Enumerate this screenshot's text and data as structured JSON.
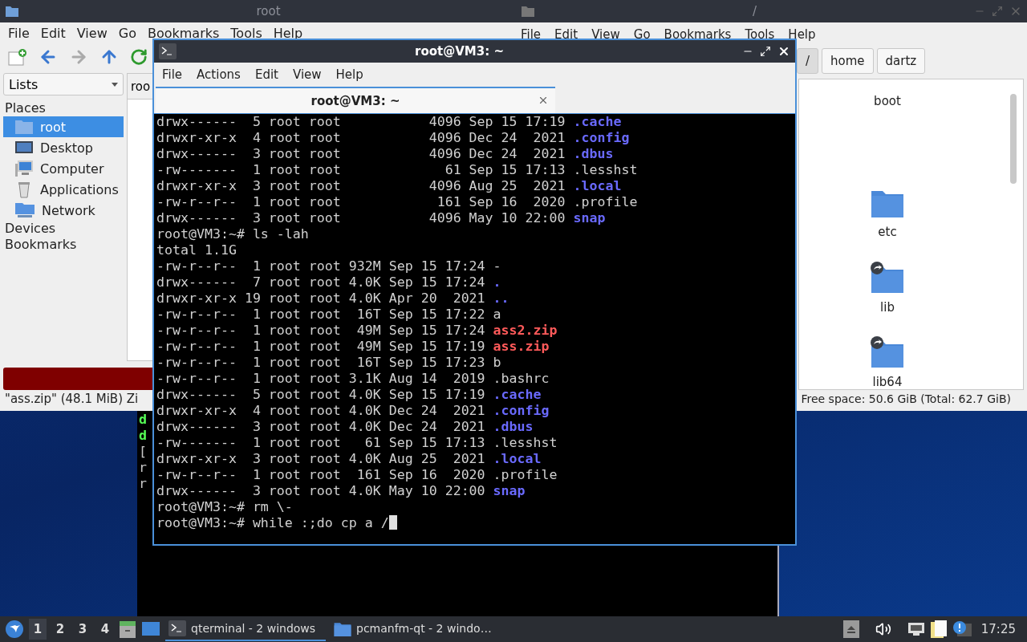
{
  "file_manager_left": {
    "title": "root",
    "menu": [
      "File",
      "Edit",
      "View",
      "Go",
      "Bookmarks",
      "Tools",
      "Help"
    ],
    "side_dropdown": "Lists",
    "places_header": "Places",
    "places": [
      {
        "label": "root",
        "kind": "home",
        "selected": true
      },
      {
        "label": "Desktop",
        "kind": "desktop",
        "selected": false
      },
      {
        "label": "Computer",
        "kind": "computer",
        "selected": false
      },
      {
        "label": "Applications",
        "kind": "applications",
        "selected": false
      },
      {
        "label": "Network",
        "kind": "network",
        "selected": false
      }
    ],
    "sections": [
      "Devices",
      "Bookmarks"
    ],
    "tab": "roo",
    "status": "\"ass.zip\" (48.1 MiB) Zi"
  },
  "file_manager_right": {
    "title": "/",
    "menu": [
      "File",
      "Edit",
      "View",
      "Go",
      "Bookmarks",
      "Tools",
      "Help"
    ],
    "path": [
      {
        "label": "/",
        "selected": true
      },
      {
        "label": "home",
        "selected": false
      },
      {
        "label": "dartz",
        "selected": false
      }
    ],
    "items": [
      {
        "label": "boot",
        "kind": "label"
      },
      {
        "label": "etc",
        "kind": "folder"
      },
      {
        "label": "lib",
        "kind": "link"
      },
      {
        "label": "lib64",
        "kind": "link"
      }
    ],
    "status": "Free space: 50.6 GiB (Total: 62.7 GiB)"
  },
  "background_terminal": {
    "lines": [
      {
        "text": "d",
        "kind": "green"
      },
      {
        "text": "d",
        "kind": "green"
      },
      {
        "text": "[",
        "kind": "plain"
      },
      {
        "text": "r",
        "kind": "plain"
      },
      {
        "text": "r",
        "kind": "plain"
      }
    ]
  },
  "terminal": {
    "title": "root@VM3: ~",
    "menu": [
      "File",
      "Actions",
      "Edit",
      "View",
      "Help"
    ],
    "tab": "root@VM3: ~",
    "cursor": true,
    "lines": [
      {
        "text": "drwx------  5 root root           4096 Sep 15 17:19 ",
        "name": ".cache",
        "kind": "dir"
      },
      {
        "text": "drwxr-xr-x  4 root root           4096 Dec 24  2021 ",
        "name": ".config",
        "kind": "dir"
      },
      {
        "text": "drwx------  3 root root           4096 Dec 24  2021 ",
        "name": ".dbus",
        "kind": "dir"
      },
      {
        "text": "-rw-------  1 root root             61 Sep 15 17:13 ",
        "name": ".lesshst",
        "kind": "file"
      },
      {
        "text": "drwxr-xr-x  3 root root           4096 Aug 25  2021 ",
        "name": ".local",
        "kind": "dir"
      },
      {
        "text": "-rw-r--r--  1 root root            161 Sep 16  2020 ",
        "name": ".profile",
        "kind": "file"
      },
      {
        "text": "drwx------  3 root root           4096 May 10 22:00 ",
        "name": "snap",
        "kind": "dir"
      },
      {
        "text": "root@VM3:~# ls -lah",
        "kind": "plain"
      },
      {
        "text": "total 1.1G",
        "kind": "plain"
      },
      {
        "text": "-rw-r--r--  1 root root 932M Sep 15 17:24 ",
        "name": "-",
        "kind": "file"
      },
      {
        "text": "drwx------  7 root root 4.0K Sep 15 17:24 ",
        "name": ".",
        "kind": "dir"
      },
      {
        "text": "drwxr-xr-x 19 root root 4.0K Apr 20  2021 ",
        "name": "..",
        "kind": "dir"
      },
      {
        "text": "-rw-r--r--  1 root root  16T Sep 15 17:22 ",
        "name": "a",
        "kind": "file"
      },
      {
        "text": "-rw-r--r--  1 root root  49M Sep 15 17:24 ",
        "name": "ass2.zip",
        "kind": "archive"
      },
      {
        "text": "-rw-r--r--  1 root root  49M Sep 15 17:19 ",
        "name": "ass.zip",
        "kind": "archive"
      },
      {
        "text": "-rw-r--r--  1 root root  16T Sep 15 17:23 ",
        "name": "b",
        "kind": "file"
      },
      {
        "text": "-rw-r--r--  1 root root 3.1K Aug 14  2019 ",
        "name": ".bashrc",
        "kind": "file"
      },
      {
        "text": "drwx------  5 root root 4.0K Sep 15 17:19 ",
        "name": ".cache",
        "kind": "dir"
      },
      {
        "text": "drwxr-xr-x  4 root root 4.0K Dec 24  2021 ",
        "name": ".config",
        "kind": "dir"
      },
      {
        "text": "drwx------  3 root root 4.0K Dec 24  2021 ",
        "name": ".dbus",
        "kind": "dir"
      },
      {
        "text": "-rw-------  1 root root   61 Sep 15 17:13 ",
        "name": ".lesshst",
        "kind": "file"
      },
      {
        "text": "drwxr-xr-x  3 root root 4.0K Aug 25  2021 ",
        "name": ".local",
        "kind": "dir"
      },
      {
        "text": "-rw-r--r--  1 root root  161 Sep 16  2020 ",
        "name": ".profile",
        "kind": "file"
      },
      {
        "text": "drwx------  3 root root 4.0K May 10 22:00 ",
        "name": "snap",
        "kind": "dir"
      },
      {
        "text": "root@VM3:~# rm \\-",
        "kind": "plain"
      },
      {
        "text": "root@VM3:~# while :;do cp a /",
        "kind": "plain"
      }
    ]
  },
  "taskbar": {
    "workspaces": [
      {
        "label": "1",
        "selected": true
      },
      {
        "label": "2",
        "selected": false
      },
      {
        "label": "3",
        "selected": false
      },
      {
        "label": "4",
        "selected": false
      }
    ],
    "tasks": [
      {
        "label": "qterminal - 2 windows",
        "kind": "terminal",
        "selected": true
      },
      {
        "label": "pcmanfm-qt - 2 windo…",
        "kind": "folder",
        "selected": false
      }
    ],
    "clock": "17:25"
  }
}
